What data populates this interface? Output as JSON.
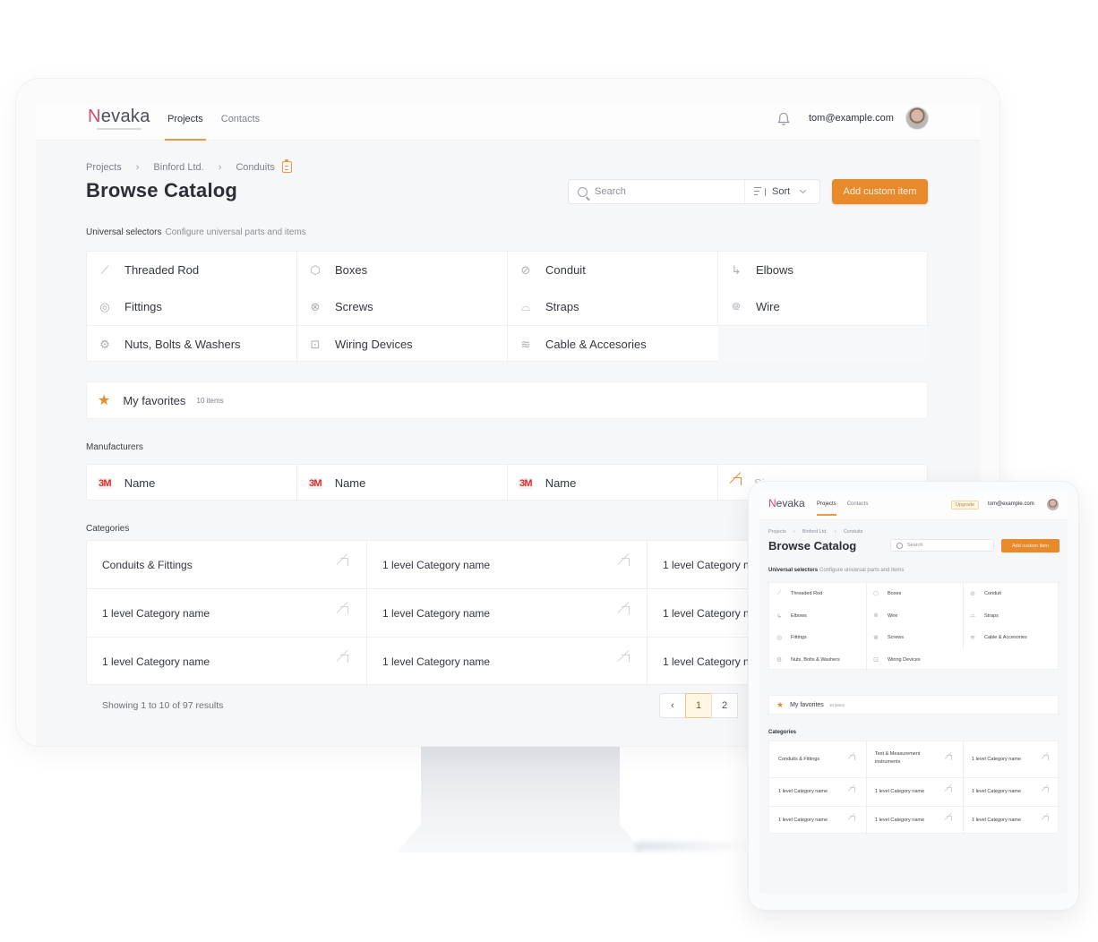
{
  "app": {
    "logo": "Nevaka"
  },
  "nav": {
    "items": [
      {
        "label": "Projects",
        "active": true
      },
      {
        "label": "Contacts",
        "active": false
      }
    ]
  },
  "header": {
    "user_email": "tom@example.com",
    "upgrade_label": "Upgrade"
  },
  "breadcrumb": [
    "Projects",
    "Binford Ltd.",
    "Conduits"
  ],
  "page": {
    "title": "Browse Catalog"
  },
  "toolbar": {
    "search_placeholder": "Search",
    "sort_label": "Sort",
    "add_label": "Add custom item"
  },
  "universal": {
    "title": "Universal selectors",
    "subtitle": "Configure universal parts and items",
    "items": [
      {
        "label": "Threaded Rod",
        "icon": "threaded-rod-icon"
      },
      {
        "label": "Boxes",
        "icon": "box-icon"
      },
      {
        "label": "Conduit",
        "icon": "conduit-icon"
      },
      {
        "label": "Elbows",
        "icon": "elbow-icon"
      },
      {
        "label": "Fittings",
        "icon": "fitting-icon"
      },
      {
        "label": "Screws",
        "icon": "screw-icon"
      },
      {
        "label": "Straps",
        "icon": "strap-icon"
      },
      {
        "label": "Wire",
        "icon": "wire-icon"
      },
      {
        "label": "Nuts, Bolts & Washers",
        "icon": "nuts-bolts-icon"
      },
      {
        "label": "Wiring Devices",
        "icon": "outlet-icon"
      },
      {
        "label": "Cable & Accesories",
        "icon": "cable-icon"
      }
    ]
  },
  "favorites": {
    "label": "My favorites",
    "count": "10 items"
  },
  "manufacturers": {
    "title": "Manufacturers",
    "items": [
      {
        "logo": "3M",
        "label": "Name"
      },
      {
        "logo": "3M",
        "label": "Name"
      },
      {
        "logo": "3M",
        "label": "Name"
      },
      {
        "logo": "arrow",
        "label": "Si"
      }
    ]
  },
  "categories": {
    "title": "Categories",
    "items": [
      "Conduits & Fittings",
      "1 level Category name",
      "1 level Category name",
      "1 level Category name",
      "1 level Category name",
      "1 level Category name",
      "1 level Category name",
      "1 level Category name",
      "1 level Category name"
    ],
    "tablet_items": [
      "Conduits & Fittings",
      "Test & Measurement instruments",
      "1 level Category name",
      "1 level Category name",
      "1 level Category name",
      "1 level Category name",
      "1 level Category name",
      "1 level Category name",
      "1 level Category name"
    ]
  },
  "pagination": {
    "summary": "Showing 1 to 10 of 97 results",
    "pages": [
      "1",
      "2"
    ],
    "current": "1",
    "prev_label": "‹"
  },
  "colors": {
    "accent": "#e8892b",
    "logo_n": "#d24b6b",
    "brand_3m": "#e22a2a"
  }
}
